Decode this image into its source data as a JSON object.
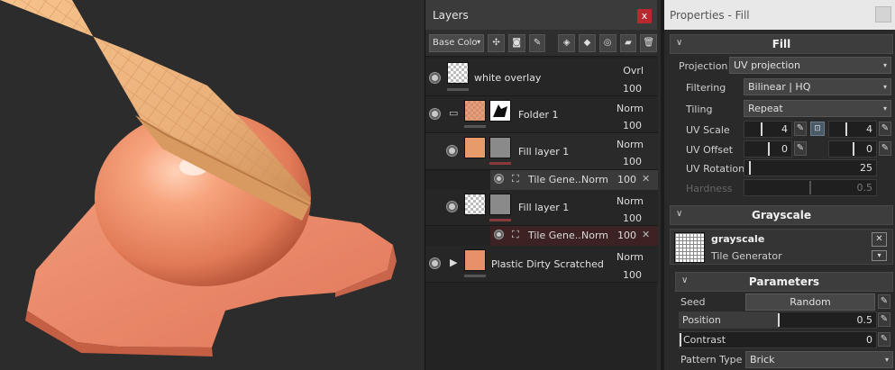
{
  "layers_panel": {
    "title": "Layers",
    "close": "x",
    "channel_dropdown": "Base Colo",
    "layers": [
      {
        "name": "white overlay",
        "blend": "Ovrl",
        "opacity": "100"
      },
      {
        "name": "Folder 1",
        "blend": "Norm",
        "opacity": "100"
      },
      {
        "name": "Fill layer 1",
        "blend": "Norm",
        "opacity": "100"
      },
      {
        "name": "Fill layer 1",
        "blend": "Norm",
        "opacity": "100"
      },
      {
        "name": "Plastic Dirty Scratched",
        "blend": "Norm",
        "opacity": "100"
      }
    ],
    "effects": [
      {
        "name": "Tile Gene...",
        "blend": "Norm",
        "opacity": "100"
      },
      {
        "name": "Tile Gene...",
        "blend": "Norm",
        "opacity": "100"
      }
    ],
    "colors": {
      "close": "#b8282f",
      "selected_effect": "#3c2222",
      "orange_thumb": "#e79a6a"
    }
  },
  "properties": {
    "title": "Properties - Fill",
    "fill_section": "Fill",
    "projection": {
      "label": "Projection",
      "value": "UV projection"
    },
    "filtering": {
      "label": "Filtering",
      "value": "Bilinear | HQ"
    },
    "tiling": {
      "label": "Tiling",
      "value": "Repeat"
    },
    "uv_scale": {
      "label": "UV Scale",
      "a": "4",
      "b": "4"
    },
    "uv_offset": {
      "label": "UV Offset",
      "a": "0",
      "b": "0"
    },
    "uv_rotation": {
      "label": "UV Rotation",
      "value": "25"
    },
    "hardness": {
      "label": "Hardness",
      "value": "0.5"
    },
    "grayscale_section": "Grayscale",
    "resource": {
      "name": "grayscale",
      "type": "Tile Generator"
    },
    "parameters_section": "Parameters",
    "seed": {
      "label": "Seed",
      "button": "Random"
    },
    "position": {
      "label": "Position",
      "value": "0.5"
    },
    "contrast": {
      "label": "Contrast",
      "value": "0"
    },
    "pattern_type": {
      "label": "Pattern Type",
      "value": "Brick"
    }
  }
}
